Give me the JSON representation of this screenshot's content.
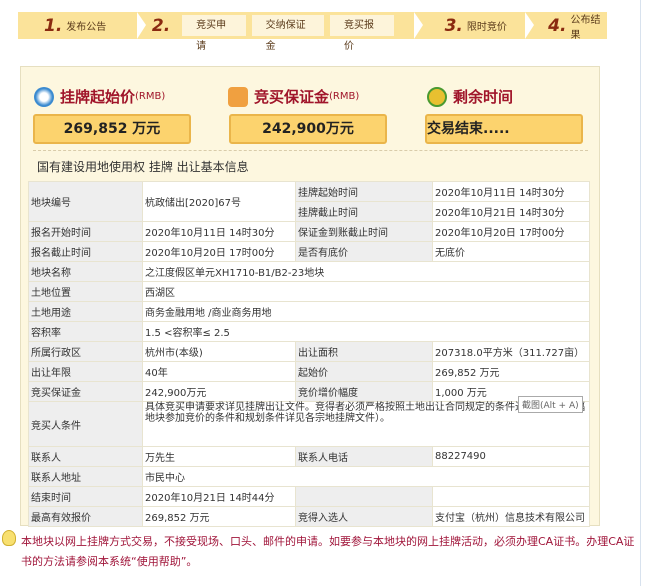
{
  "steps": [
    {
      "num": "1.",
      "label": "发布公告"
    },
    {
      "num": "2.",
      "subs": [
        "竞买申请",
        "交纳保证金",
        "竞买报价"
      ]
    },
    {
      "num": "3.",
      "label": "限时竞价"
    },
    {
      "num": "4.",
      "label": "公布结果"
    }
  ],
  "summary": {
    "start_price": {
      "title": "挂牌起始价",
      "unit": "(RMB)",
      "value": "269,852 万元"
    },
    "deposit": {
      "title": "竞买保证金",
      "unit": "(RMB)",
      "value": "242,900万元"
    },
    "remaining": {
      "title": "剩余时间",
      "value": "交易结束....."
    }
  },
  "section_title": "国有建设用地使用权 挂牌 出让基本信息",
  "table": {
    "r1": [
      "地块编号",
      "杭政储出[2020]67号",
      "挂牌起始时间",
      "2020年10月11日 14时30分",
      "挂牌截止时间",
      "2020年10月21日 14时30分"
    ],
    "r3": [
      "报名开始时间",
      "2020年10月11日 14时30分",
      "保证金到账截止时间",
      "2020年10月20日 17时00分"
    ],
    "r4": [
      "报名截止时间",
      "2020年10月20日 17时00分",
      "是否有底价",
      "无底价"
    ],
    "r5": [
      "地块名称",
      "之江度假区单元XH1710-B1/B2-23地块"
    ],
    "r6": [
      "土地位置",
      "西湖区"
    ],
    "r7": [
      "土地用途",
      "商务金融用地 /商业商务用地"
    ],
    "r8": [
      "容积率",
      "1.5 <容积率≤ 2.5"
    ],
    "r9": [
      "所属行政区",
      "杭州市(本级)",
      "出让面积",
      "207318.0平方米（311.727亩）"
    ],
    "r10": [
      "出让年限",
      "40年",
      "起始价",
      "269,852 万元"
    ],
    "r11": [
      "竞买保证金",
      "242,900万元",
      "竞价增价幅度",
      "1,000 万元"
    ],
    "r12": [
      "竞买人条件",
      "具体竞买申请要求详见挂牌出让文件。竞得者必须严格按照土地出让合同规定的条件进行开发（各幅地块参加竞价的条件和规划条件详见各宗地挂牌文件）。"
    ],
    "r13": [
      "联系人",
      "万先生",
      "联系人电话",
      "88227490"
    ],
    "r14": [
      "联系人地址",
      "市民中心"
    ],
    "r15": [
      "结束时间",
      "2020年10月21日 14时44分"
    ],
    "r16": [
      "最高有效报价",
      "269,852 万元",
      "竞得入选人",
      "支付宝（杭州）信息技术有限公司"
    ]
  },
  "tooltip": "截图(Alt + A)",
  "note": "本地块以网上挂牌方式交易，不接受现场、口头、邮件的申请。如要参与本地块的网上挂牌活动，必须办理CA证书。办理CA证书的方法请参阅本系统“使用帮助”。",
  "colors": {
    "accent": "#a0152a",
    "bar": "#fbe39a",
    "box": "#fcd36e"
  }
}
